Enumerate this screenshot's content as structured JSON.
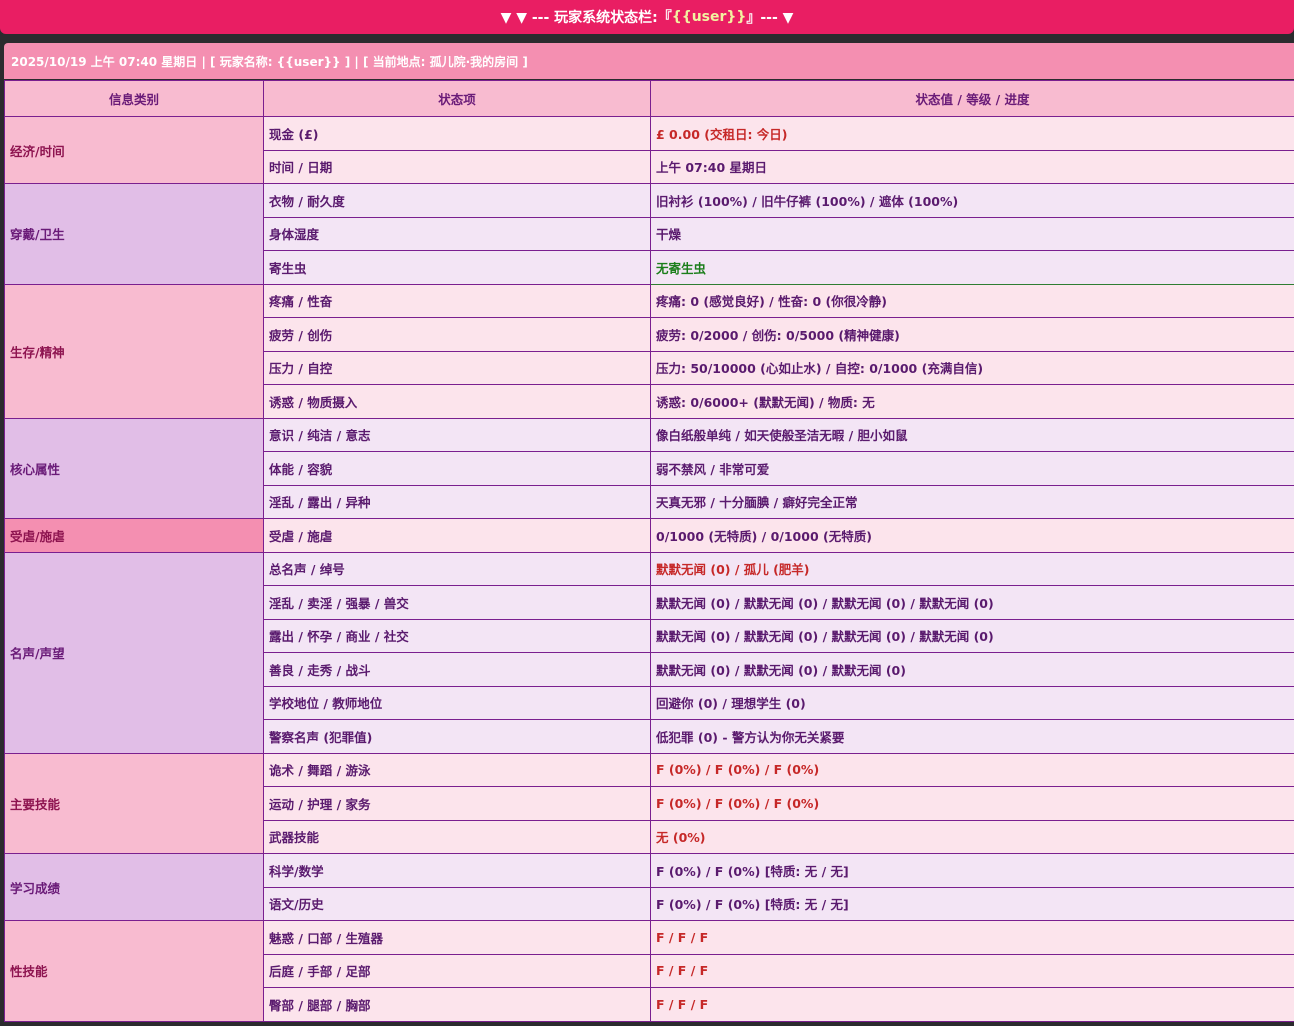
{
  "header": {
    "prefix": "▼ ▼ --- 玩家系统状态栏:『",
    "user": "{{user}}",
    "suffix": "』--- ▼"
  },
  "infobar": {
    "text": "2025/10/19 上午 07:40 星期日 | [ 玩家名称: {{user}} ] | [ 当前地点: 孤儿院·我的房间 ]"
  },
  "table": {
    "headers": [
      "信息类别",
      "状态项",
      "状态值 / 等级 / 进度"
    ],
    "groups": [
      {
        "category": "经济/时间",
        "theme": "pink",
        "rows": [
          {
            "item": "现金 (£)",
            "value": "£ 0.00 (交租日: 今日)",
            "style": "red"
          },
          {
            "item": "时间 / 日期",
            "value": "上午 07:40 星期日",
            "style": ""
          }
        ]
      },
      {
        "category": "穿戴/卫生",
        "theme": "purple",
        "rows": [
          {
            "item": "衣物 / 耐久度",
            "value": "旧衬衫 (100%) / 旧牛仔裤 (100%) / 遮体 (100%)",
            "style": ""
          },
          {
            "item": "身体湿度",
            "value": "干燥",
            "style": ""
          },
          {
            "item": "寄生虫",
            "value": "无寄生虫",
            "style": "green"
          }
        ]
      },
      {
        "category": "生存/精神",
        "theme": "pink",
        "rows": [
          {
            "item": "疼痛 / 性奋",
            "value": "疼痛: 0 (感觉良好) / 性奋: 0 (你很冷静)",
            "style": ""
          },
          {
            "item": "疲劳 / 创伤",
            "value": "疲劳: 0/2000 / 创伤: 0/5000 (精神健康)",
            "style": ""
          },
          {
            "item": "压力 / 自控",
            "value": "压力: 50/10000 (心如止水) / 自控: 0/1000 (充满自信)",
            "style": ""
          },
          {
            "item": "诱惑 / 物质摄入",
            "value": "诱惑: 0/6000+ (默默无闻) / 物质: 无",
            "style": ""
          }
        ]
      },
      {
        "category": "核心属性",
        "theme": "purple",
        "rows": [
          {
            "item": "意识 / 纯洁 / 意志",
            "value": "像白纸般单纯 / 如天使般圣洁无暇 / 胆小如鼠",
            "style": ""
          },
          {
            "item": "体能 / 容貌",
            "value": "弱不禁风 / 非常可爱",
            "style": ""
          },
          {
            "item": "淫乱 / 露出 / 异种",
            "value": "天真无邪 / 十分腼腆 / 癖好完全正常",
            "style": ""
          }
        ]
      },
      {
        "category": "受虐/施虐",
        "theme": "abuse",
        "rows": [
          {
            "item": "受虐 / 施虐",
            "value": "0/1000 (无特质) / 0/1000 (无特质)",
            "style": ""
          }
        ]
      },
      {
        "category": "名声/声望",
        "theme": "purple",
        "rows": [
          {
            "item": "总名声 / 绰号",
            "value": "默默无闻 (0) / 孤儿 (肥羊)",
            "style": "red"
          },
          {
            "item": "淫乱 / 卖淫 / 强暴 / 兽交",
            "value": "默默无闻 (0) / 默默无闻 (0) / 默默无闻 (0) / 默默无闻 (0)",
            "style": ""
          },
          {
            "item": "露出 / 怀孕 / 商业 / 社交",
            "value": "默默无闻 (0) / 默默无闻 (0) / 默默无闻 (0) / 默默无闻 (0)",
            "style": ""
          },
          {
            "item": "善良 / 走秀 / 战斗",
            "value": "默默无闻 (0) / 默默无闻 (0) / 默默无闻 (0)",
            "style": ""
          },
          {
            "item": "学校地位 / 教师地位",
            "value": "回避你 (0) / 理想学生 (0)",
            "style": ""
          },
          {
            "item": "警察名声 (犯罪值)",
            "value": "低犯罪 (0) - 警方认为你无关紧要",
            "style": ""
          }
        ]
      },
      {
        "category": "主要技能",
        "theme": "pink",
        "rows": [
          {
            "item": "诡术 / 舞蹈 / 游泳",
            "value": "F (0%) / F (0%) / F (0%)",
            "style": "red"
          },
          {
            "item": "运动 / 护理 / 家务",
            "value": "F (0%) / F (0%) / F (0%)",
            "style": "red"
          },
          {
            "item": "武器技能",
            "value": "无 (0%)",
            "style": "red"
          }
        ]
      },
      {
        "category": "学习成绩",
        "theme": "purple",
        "rows": [
          {
            "item": "科学/数学",
            "value": "F (0%) / F (0%) [特质: 无 / 无]",
            "style": ""
          },
          {
            "item": "语文/历史",
            "value": "F (0%) / F (0%) [特质: 无 / 无]",
            "style": ""
          }
        ]
      },
      {
        "category": "性技能",
        "theme": "pink",
        "rows": [
          {
            "item": "魅惑 / 口部 / 生殖器",
            "value": "F / F / F",
            "style": "red"
          },
          {
            "item": "后庭 / 手部 / 足部",
            "value": "F / F / F",
            "style": "red"
          },
          {
            "item": "臀部 / 腿部 / 胸部",
            "value": "F / F / F",
            "style": "red"
          }
        ]
      }
    ]
  }
}
